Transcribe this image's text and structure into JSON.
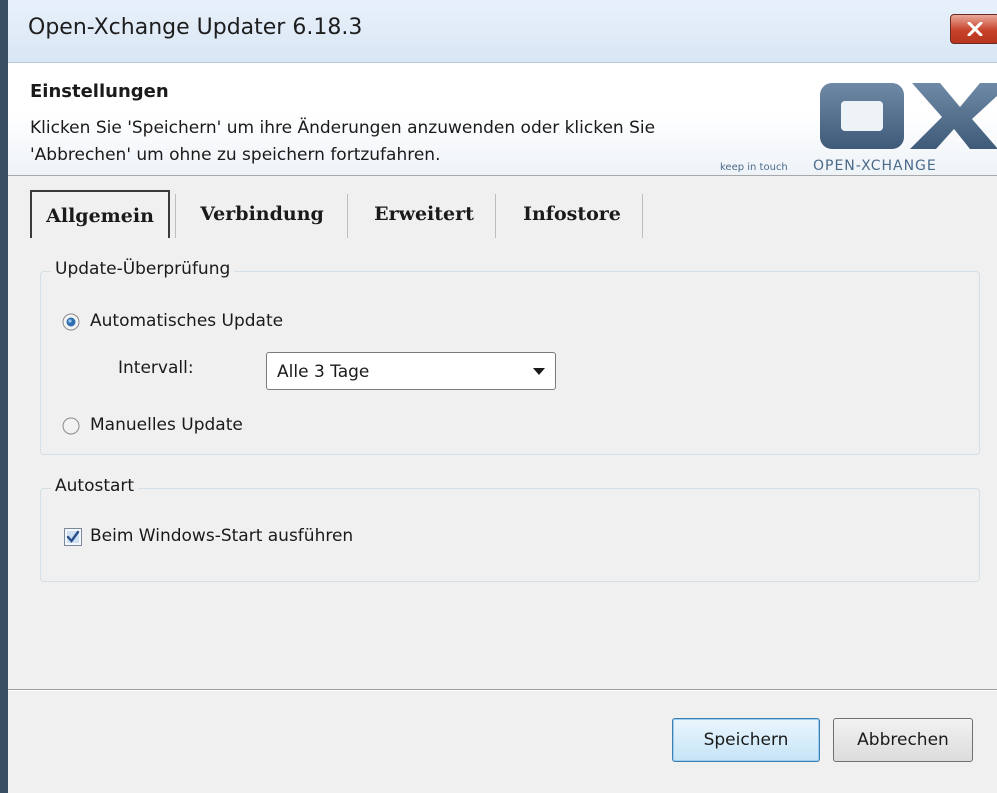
{
  "window": {
    "title": "Open-Xchange Updater 6.18.3"
  },
  "header": {
    "title": "Einstellungen",
    "description_line1": "Klicken Sie 'Speichern' um ihre Änderungen anzuwenden oder klicken Sie",
    "description_line2": "'Abbrechen' um ohne zu speichern fortzufahren.",
    "logo": {
      "mark": "OX",
      "tagline": "keep in touch",
      "brand": "OPEN-XCHANGE"
    }
  },
  "tabs": [
    {
      "label": "Allgemein",
      "active": true
    },
    {
      "label": "Verbindung",
      "active": false
    },
    {
      "label": "Erweitert",
      "active": false
    },
    {
      "label": "Infostore",
      "active": false
    }
  ],
  "update_group": {
    "label": "Update-Überprüfung",
    "automatic_label": "Automatisches Update",
    "automatic_selected": true,
    "interval_label": "Intervall:",
    "interval_value": "Alle 3 Tage",
    "manual_label": "Manuelles Update",
    "manual_selected": false
  },
  "autostart_group": {
    "label": "Autostart",
    "checkbox_label": "Beim Windows-Start ausführen",
    "checked": true
  },
  "buttons": {
    "save": "Speichern",
    "cancel": "Abbrechen"
  },
  "colors": {
    "accent": "#3c7fb1",
    "logo": "#4a6a8a",
    "close": "#c7422a"
  }
}
